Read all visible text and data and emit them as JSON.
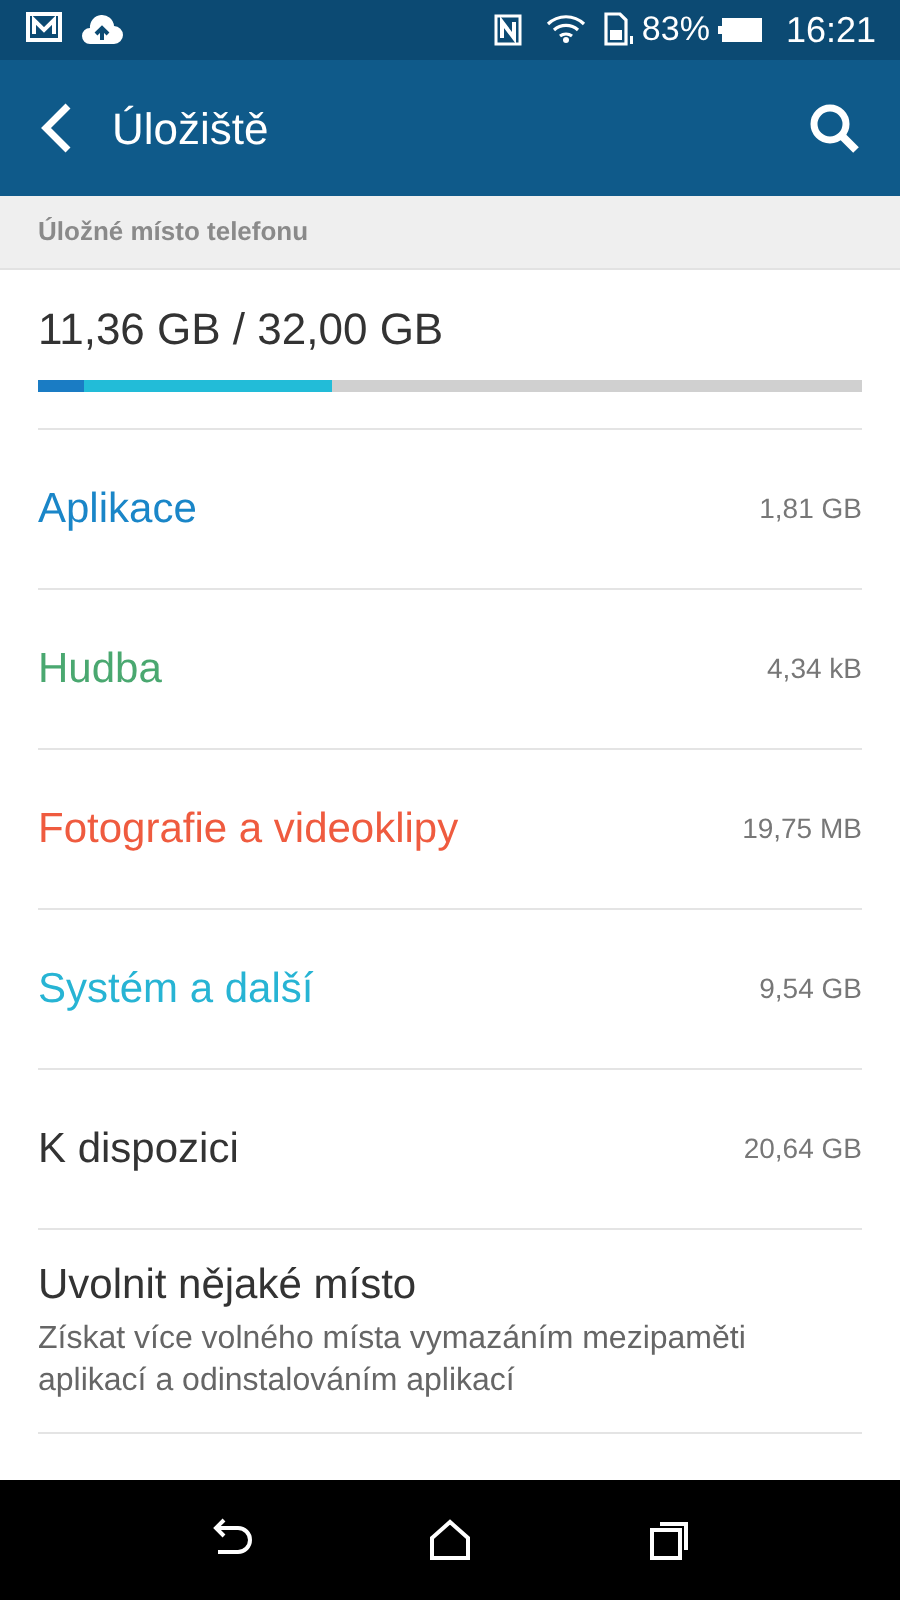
{
  "status_bar": {
    "battery": "83%",
    "time": "16:21"
  },
  "app_bar": {
    "title": "Úložiště"
  },
  "section": {
    "title": "Úložné místo telefonu"
  },
  "usage": {
    "text": "11,36 GB / 32,00 GB",
    "segments": [
      {
        "color": "#1a7cc4",
        "level": 0.056
      },
      {
        "color": "#22bcd8",
        "level": 0.356
      }
    ]
  },
  "categories": [
    {
      "label": "Aplikace",
      "size": "1,81 GB",
      "color": "#1a86c8"
    },
    {
      "label": "Hudba",
      "size": "4,34 kB",
      "color": "#4aa870"
    },
    {
      "label": "Fotografie a videoklipy",
      "size": "19,75 MB",
      "color": "#ef5b3f"
    },
    {
      "label": "Systém a další",
      "size": "9,54 GB",
      "color": "#27b4d4"
    },
    {
      "label": "K dispozici",
      "size": "20,64 GB",
      "color": "#333333"
    }
  ],
  "free_up": {
    "title": "Uvolnit nějaké místo",
    "description": "Získat více volného místa vymazáním mezipaměti aplikací a odinstalováním aplikací"
  }
}
